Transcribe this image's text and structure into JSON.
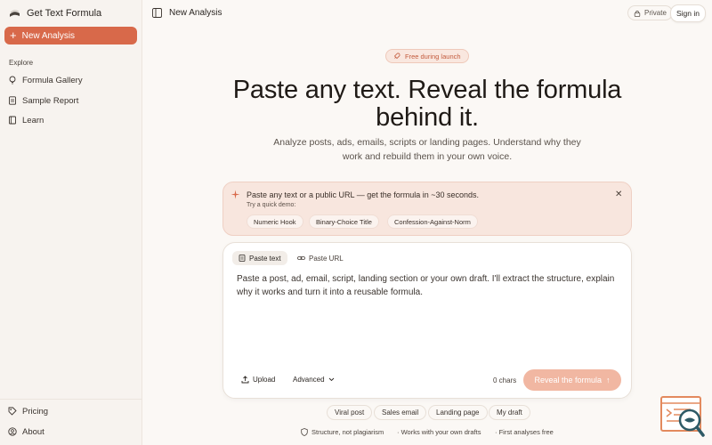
{
  "sidebar": {
    "brand": "Get Text Formula",
    "new_button": "New Analysis",
    "explore_label": "Explore",
    "items": [
      {
        "label": "Formula Gallery",
        "icon": "lightbulb-icon"
      },
      {
        "label": "Sample Report",
        "icon": "document-icon"
      },
      {
        "label": "Learn",
        "icon": "book-icon"
      }
    ],
    "bottom_items": [
      {
        "label": "Pricing",
        "icon": "tag-icon"
      },
      {
        "label": "About",
        "icon": "user-circle-icon"
      }
    ]
  },
  "header": {
    "title": "New Analysis",
    "private_label": "Private",
    "signin_label": "Sign in"
  },
  "hero": {
    "badge": "Free during launch",
    "title": "Paste any text. Reveal the formula behind it.",
    "subtitle": "Analyze posts, ads, emails, scripts or landing pages. Understand why they work and rebuild them in your own voice."
  },
  "tip": {
    "text": "Paste any text or a public URL — get the formula in ~30 seconds.",
    "demo_label": "Try a quick demo:",
    "chips": [
      "Numeric Hook",
      "Binary-Choice Title",
      "Confession-Against-Norm"
    ]
  },
  "editor": {
    "tab_text": "Paste text",
    "tab_url": "Paste URL",
    "placeholder": "Paste a post, ad, email, script, landing section or your own draft. I'll extract the structure, explain why it works and turn it into a reusable formula.",
    "upload_label": "Upload",
    "advanced_label": "Advanced",
    "chars": "0 chars",
    "reveal_label": "Reveal the formula"
  },
  "suggestions": [
    "Viral post",
    "Sales email",
    "Landing page",
    "My draft"
  ],
  "footer": {
    "item1": "Structure, not plagiarism",
    "item2": "· Works with your own drafts",
    "item3": "· First analyses free"
  },
  "colors": {
    "accent": "#d8694a",
    "accent_light": "#f1b7a2",
    "background": "#fbf8f5",
    "sidebar_bg": "#f7f3ef"
  }
}
